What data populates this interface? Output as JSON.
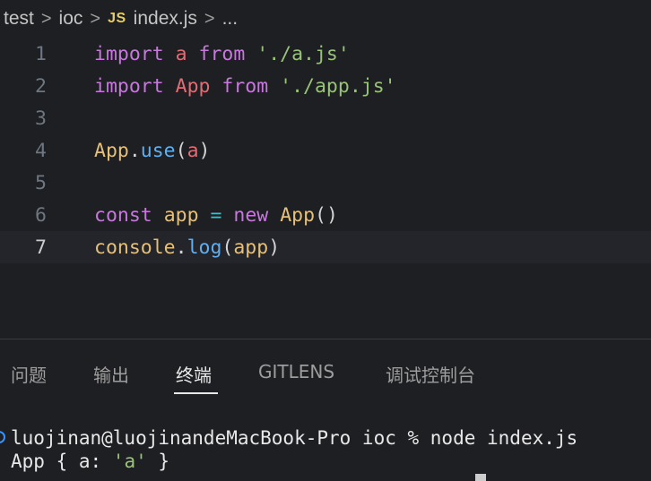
{
  "breadcrumb": {
    "items": [
      "test",
      "ioc",
      "index.js",
      "..."
    ],
    "separator": ">",
    "file_badge": "JS"
  },
  "editor": {
    "line_numbers": [
      "1",
      "2",
      "3",
      "4",
      "5",
      "6",
      "7"
    ],
    "active_line": "7",
    "lines": [
      [
        {
          "t": "import",
          "c": "kw"
        },
        {
          "t": " ",
          "c": "plain"
        },
        {
          "t": "a",
          "c": "var"
        },
        {
          "t": " ",
          "c": "plain"
        },
        {
          "t": "from",
          "c": "kw"
        },
        {
          "t": " ",
          "c": "plain"
        },
        {
          "t": "'./a.js'",
          "c": "str"
        }
      ],
      [
        {
          "t": "import",
          "c": "kw"
        },
        {
          "t": " ",
          "c": "plain"
        },
        {
          "t": "App",
          "c": "var"
        },
        {
          "t": " ",
          "c": "plain"
        },
        {
          "t": "from",
          "c": "kw"
        },
        {
          "t": " ",
          "c": "plain"
        },
        {
          "t": "'./app.js'",
          "c": "str"
        }
      ],
      [],
      [
        {
          "t": "App",
          "c": "cls"
        },
        {
          "t": ".",
          "c": "plain"
        },
        {
          "t": "use",
          "c": "fn"
        },
        {
          "t": "(",
          "c": "plain"
        },
        {
          "t": "a",
          "c": "var"
        },
        {
          "t": ")",
          "c": "plain"
        }
      ],
      [],
      [
        {
          "t": "const",
          "c": "kw"
        },
        {
          "t": " ",
          "c": "plain"
        },
        {
          "t": "app",
          "c": "cls"
        },
        {
          "t": " ",
          "c": "plain"
        },
        {
          "t": "=",
          "c": "op"
        },
        {
          "t": " ",
          "c": "plain"
        },
        {
          "t": "new",
          "c": "kw"
        },
        {
          "t": " ",
          "c": "plain"
        },
        {
          "t": "App",
          "c": "cls"
        },
        {
          "t": "()",
          "c": "plain"
        }
      ],
      [
        {
          "t": "console",
          "c": "cls"
        },
        {
          "t": ".",
          "c": "plain"
        },
        {
          "t": "log",
          "c": "fn"
        },
        {
          "t": "(",
          "c": "plain"
        },
        {
          "t": "app",
          "c": "cls"
        },
        {
          "t": ")",
          "c": "plain"
        }
      ]
    ]
  },
  "panel": {
    "tabs": [
      {
        "label": "问题",
        "active": false
      },
      {
        "label": "输出",
        "active": false
      },
      {
        "label": "终端",
        "active": true
      },
      {
        "label": "GITLENS",
        "active": false
      },
      {
        "label": "调试控制台",
        "active": false
      }
    ]
  },
  "terminal": {
    "prompt": "luojinan@luojinandeMacBook-Pro ioc % node index.js",
    "output_prefix": "App { a: ",
    "output_value": "'a'",
    "output_suffix": " }"
  },
  "colors": {
    "keyword": "#c678dd",
    "variable": "#e06c75",
    "string": "#98c379",
    "class": "#e5c07b",
    "function": "#61afef",
    "operator": "#56b6c2",
    "background": "#1e1f22",
    "accent": "#3794ff"
  }
}
